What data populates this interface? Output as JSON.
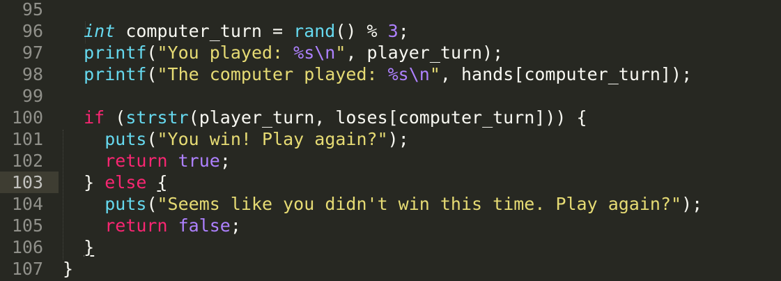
{
  "editor": {
    "colors": {
      "background": "#272822",
      "line_number": "#90908a",
      "active_line": "#3e3d32",
      "keyword": "#f92672",
      "function": "#66d9ef",
      "string": "#e6db74",
      "number": "#ae81ff",
      "text": "#f8f8f2"
    },
    "active_line_number": "103",
    "line_numbers": [
      "95",
      "96",
      "97",
      "98",
      "99",
      "100",
      "101",
      "102",
      "103",
      "104",
      "105",
      "106",
      "107"
    ],
    "lines": [
      {
        "number": "95",
        "tokens": []
      },
      {
        "number": "96",
        "tokens": [
          {
            "text": "  ",
            "cls": "pn"
          },
          {
            "text": "int",
            "cls": "t"
          },
          {
            "text": " computer_turn = ",
            "cls": "pn"
          },
          {
            "text": "rand",
            "cls": "f"
          },
          {
            "text": "() % ",
            "cls": "pn"
          },
          {
            "text": "3",
            "cls": "n"
          },
          {
            "text": ";",
            "cls": "pn"
          }
        ]
      },
      {
        "number": "97",
        "tokens": [
          {
            "text": "  ",
            "cls": "pn"
          },
          {
            "text": "printf",
            "cls": "f"
          },
          {
            "text": "(",
            "cls": "pn"
          },
          {
            "text": "\"You played: ",
            "cls": "s"
          },
          {
            "text": "%s\\n",
            "cls": "n"
          },
          {
            "text": "\"",
            "cls": "s"
          },
          {
            "text": ", player_turn);",
            "cls": "pn"
          }
        ]
      },
      {
        "number": "98",
        "tokens": [
          {
            "text": "  ",
            "cls": "pn"
          },
          {
            "text": "printf",
            "cls": "f"
          },
          {
            "text": "(",
            "cls": "pn"
          },
          {
            "text": "\"The computer played: ",
            "cls": "s"
          },
          {
            "text": "%s\\n",
            "cls": "n"
          },
          {
            "text": "\"",
            "cls": "s"
          },
          {
            "text": ", hands[computer_turn]);",
            "cls": "pn"
          }
        ]
      },
      {
        "number": "99",
        "tokens": []
      },
      {
        "number": "100",
        "tokens": [
          {
            "text": "  ",
            "cls": "pn"
          },
          {
            "text": "if",
            "cls": "k"
          },
          {
            "text": " (",
            "cls": "pn"
          },
          {
            "text": "strstr",
            "cls": "f"
          },
          {
            "text": "(player_turn, loses[computer_turn])) {",
            "cls": "pn"
          }
        ]
      },
      {
        "number": "101",
        "tokens": [
          {
            "text": "    ",
            "cls": "pn"
          },
          {
            "text": "puts",
            "cls": "f"
          },
          {
            "text": "(",
            "cls": "pn"
          },
          {
            "text": "\"You win! Play again?\"",
            "cls": "s"
          },
          {
            "text": ");",
            "cls": "pn"
          }
        ]
      },
      {
        "number": "102",
        "tokens": [
          {
            "text": "    ",
            "cls": "pn"
          },
          {
            "text": "return",
            "cls": "k"
          },
          {
            "text": " ",
            "cls": "pn"
          },
          {
            "text": "true",
            "cls": "n"
          },
          {
            "text": ";",
            "cls": "pn"
          }
        ]
      },
      {
        "number": "103",
        "tokens": [
          {
            "text": "  } ",
            "cls": "pn"
          },
          {
            "text": "else",
            "cls": "k"
          },
          {
            "text": " ",
            "cls": "pn"
          },
          {
            "text": "{",
            "cls": "pn u"
          }
        ]
      },
      {
        "number": "104",
        "tokens": [
          {
            "text": "    ",
            "cls": "pn"
          },
          {
            "text": "puts",
            "cls": "f"
          },
          {
            "text": "(",
            "cls": "pn"
          },
          {
            "text": "\"Seems like you didn't win this time. Play again?\"",
            "cls": "s"
          },
          {
            "text": ");",
            "cls": "pn"
          }
        ]
      },
      {
        "number": "105",
        "tokens": [
          {
            "text": "    ",
            "cls": "pn"
          },
          {
            "text": "return",
            "cls": "k"
          },
          {
            "text": " ",
            "cls": "pn"
          },
          {
            "text": "false",
            "cls": "n"
          },
          {
            "text": ";",
            "cls": "pn"
          }
        ]
      },
      {
        "number": "106",
        "tokens": [
          {
            "text": "  ",
            "cls": "pn"
          },
          {
            "text": "}",
            "cls": "pn u"
          }
        ]
      },
      {
        "number": "107",
        "tokens": [
          {
            "text": "}",
            "cls": "pn"
          }
        ]
      }
    ]
  }
}
